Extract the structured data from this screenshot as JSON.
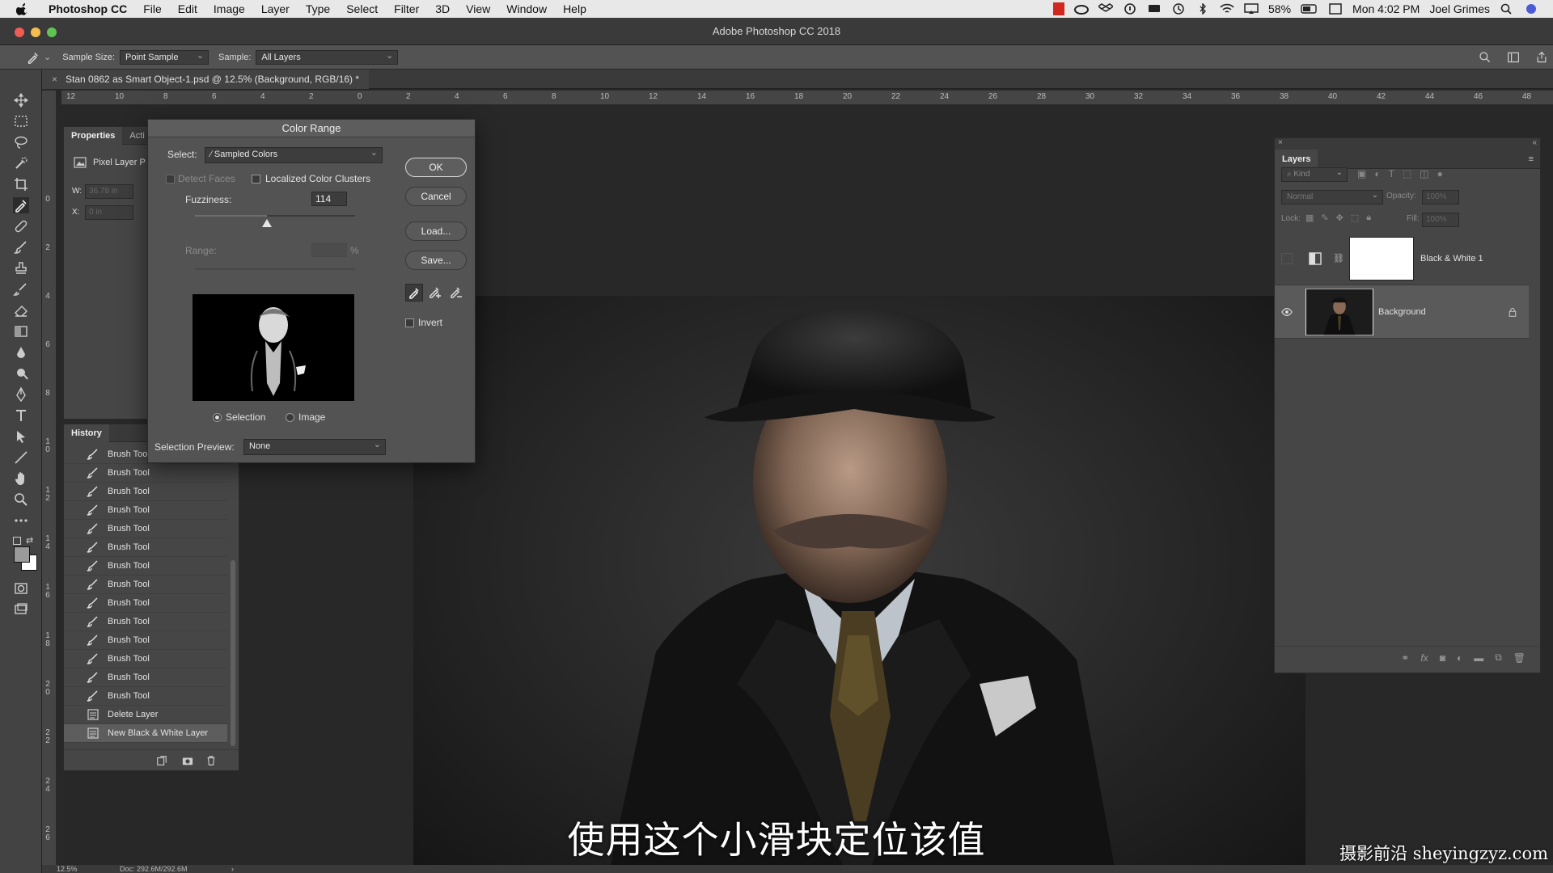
{
  "menubar": {
    "app": "Photoshop CC",
    "items": [
      "File",
      "Edit",
      "Image",
      "Layer",
      "Type",
      "Select",
      "Filter",
      "3D",
      "View",
      "Window",
      "Help"
    ],
    "battery": "58%",
    "clock": "Mon 4:02 PM",
    "user": "Joel Grimes"
  },
  "window": {
    "title": "Adobe Photoshop CC 2018"
  },
  "options": {
    "sample_size_label": "Sample Size:",
    "sample_size_value": "Point Sample",
    "sample_label": "Sample:",
    "sample_value": "All Layers"
  },
  "document": {
    "tab": "Stan 0862 as Smart Object-1.psd @ 12.5% (Background, RGB/16) *",
    "zoom": "12.5%",
    "doc_size": "Doc: 292.6M/292.6M"
  },
  "rulers": {
    "h": [
      "12",
      "10",
      "8",
      "6",
      "4",
      "2",
      "0",
      "2",
      "4",
      "6",
      "8",
      "10",
      "12",
      "14",
      "16",
      "18",
      "20",
      "22",
      "24",
      "26",
      "28",
      "30",
      "32",
      "34",
      "36",
      "38",
      "40",
      "42",
      "44",
      "46",
      "48"
    ],
    "v": [
      "0",
      "2",
      "4",
      "6",
      "8",
      "1 0",
      "1 2",
      "1 4",
      "1 6",
      "1 8",
      "2 0",
      "2 2",
      "2 4",
      "2 6"
    ]
  },
  "properties": {
    "tabs": [
      "Properties",
      "Acti"
    ],
    "pixel_layer": "Pixel Layer P",
    "w_label": "W:",
    "w_value": "36.78 in",
    "x_label": "X:",
    "x_value": "0 in"
  },
  "history": {
    "title": "History",
    "items": [
      {
        "label": "Brush Tool"
      },
      {
        "label": "Brush Tool"
      },
      {
        "label": "Brush Tool"
      },
      {
        "label": "Brush Tool"
      },
      {
        "label": "Brush Tool"
      },
      {
        "label": "Brush Tool"
      },
      {
        "label": "Brush Tool"
      },
      {
        "label": "Brush Tool"
      },
      {
        "label": "Brush Tool"
      },
      {
        "label": "Brush Tool"
      },
      {
        "label": "Brush Tool"
      },
      {
        "label": "Brush Tool"
      },
      {
        "label": "Brush Tool"
      },
      {
        "label": "Brush Tool"
      },
      {
        "label": "Delete Layer"
      },
      {
        "label": "New Black & White Layer"
      }
    ]
  },
  "dialog": {
    "title": "Color Range",
    "select_label": "Select:",
    "select_value": "Sampled Colors",
    "detect_faces": "Detect Faces",
    "localized": "Localized Color Clusters",
    "fuzziness_label": "Fuzziness:",
    "fuzziness_value": "114",
    "fuzziness_level": 0.45,
    "range_label": "Range:",
    "range_unit": "%",
    "radio_selection": "Selection",
    "radio_image": "Image",
    "preview_label": "Selection Preview:",
    "preview_value": "None",
    "ok": "OK",
    "cancel": "Cancel",
    "load": "Load...",
    "save": "Save...",
    "invert": "Invert"
  },
  "layers": {
    "title": "Layers",
    "kind": "Kind",
    "blend": "Normal",
    "opacity_label": "Opacity:",
    "opacity_value": "100%",
    "lock_label": "Lock:",
    "fill_label": "Fill:",
    "fill_value": "100%",
    "items": [
      {
        "name": "Black & White 1"
      },
      {
        "name": "Background"
      }
    ]
  },
  "overlay": {
    "subtitle": "使用这个小滑块定位该值",
    "watermark": "摄影前沿 sheyingzyz.com"
  },
  "colors": {
    "accent_red": "#d0281e",
    "traffic_red": "#ee5c54",
    "traffic_yellow": "#f5bd4f",
    "traffic_green": "#5fc454"
  }
}
